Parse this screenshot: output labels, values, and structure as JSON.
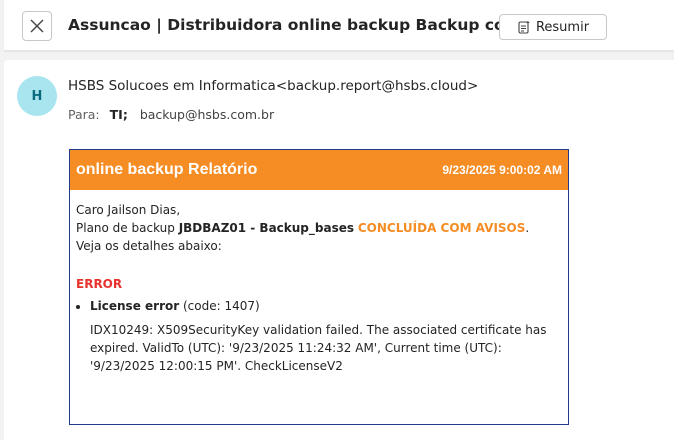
{
  "header": {
    "subject": "Assuncao | Distribuidora online backup Backup completed",
    "summarize_label": "Resumir"
  },
  "message": {
    "avatar_initial": "H",
    "sender": "HSBS Solucoes em Informatica<backup.report@hsbs.cloud>",
    "to_label": "Para:",
    "recipients": [
      "TI;",
      "backup@hsbs.com.br"
    ]
  },
  "report": {
    "title": "online backup Relatório",
    "date": "9/23/2025 9:00:02 AM",
    "greeting": "Caro Jailson Dias,",
    "plan_prefix": "Plano de backup ",
    "plan_name": "JBDBAZ01 - Backup_bases",
    "status": "CONCLUÍDA COM AVISOS",
    "status_suffix": ".",
    "details_line": "Veja os detalhes abaixo:",
    "error_heading": "ERROR",
    "error_name": "License error",
    "error_code": " (code: 1407)",
    "error_detail": "IDX10249: X509SecurityKey validation failed. The associated certificate has expired. ValidTo (UTC): '9/23/2025 11:24:32 AM', Current time (UTC): '9/23/2025 12:00:15 PM'. CheckLicenseV2"
  },
  "colors": {
    "accent_orange": "#f68c24",
    "error_red": "#e8322e",
    "avatar_bg": "#a8e5ef",
    "border_blue": "#1f3c88"
  },
  "icons": {
    "close": "close-icon",
    "summarize": "summarize-icon"
  }
}
